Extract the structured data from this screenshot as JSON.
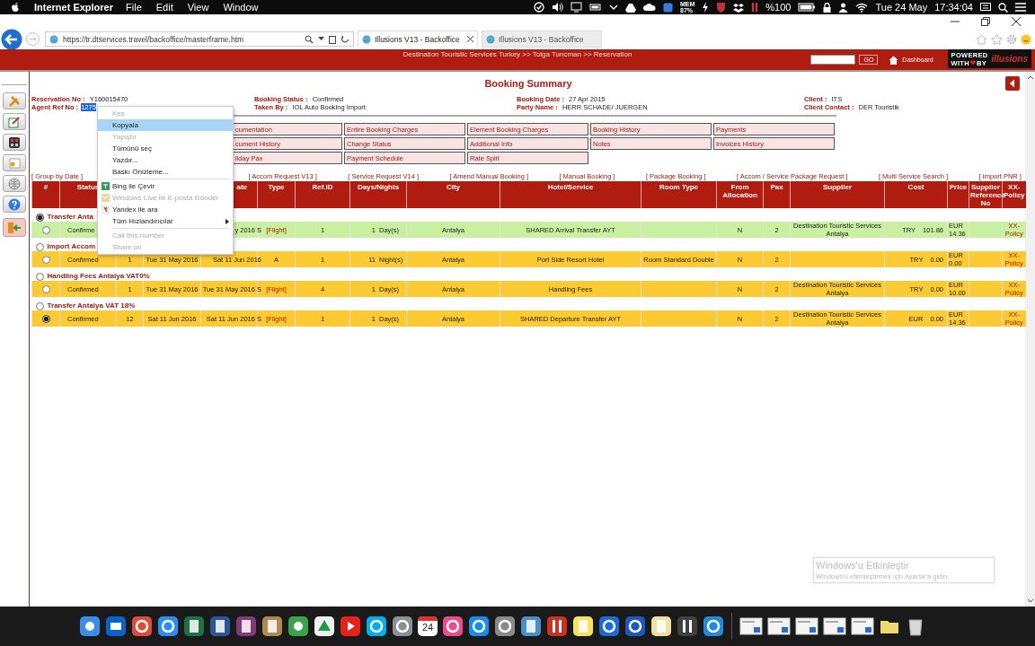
{
  "menubar": {
    "app": "Internet Explorer",
    "menus": [
      "File",
      "Edit",
      "View",
      "Window"
    ],
    "mem_label": "MEM",
    "mem_value": "87%",
    "battery": "%100",
    "date": "Tue 24 May",
    "time": "17:34:04"
  },
  "browser": {
    "address": "https://tr.dtservices.travel/backoffice/masterframe.htm",
    "tabs": [
      {
        "title": "Illusions V13 - Backoffice",
        "selected": true
      },
      {
        "title": "Illusions V13 - Backoffice",
        "selected": false
      }
    ]
  },
  "header": {
    "breadcrumb": "Destination Touristic Services Turkey >> Tolga Tuncman >> Reservation",
    "go": "GO",
    "dashboard": "Dashboard",
    "logo_top": "POWERED",
    "logo_with": "WITH",
    "logo_by": "BY",
    "logo_brand": "illusions"
  },
  "page_title": "Booking Summary",
  "info_columns": [
    [
      {
        "label": "Reservation No :",
        "value": "Y160015470",
        "highlighted": false
      },
      {
        "label": "Agent Ref No :",
        "value": "1275",
        "highlighted": true
      }
    ],
    [
      {
        "label": "Booking Status :",
        "value": "Confirmed",
        "highlighted": false
      },
      {
        "label": "Taken By :",
        "value": "IOL Auto Booking Import",
        "highlighted": false
      }
    ],
    [
      {
        "label": "Booking Date :",
        "value": "27 Apr 2015",
        "highlighted": false
      },
      {
        "label": "Party Name :",
        "value": "HERR SCHADE/ JUERGEN",
        "highlighted": false
      }
    ],
    [
      {
        "label": "Client :",
        "value": "ITS",
        "highlighted": false
      },
      {
        "label": "Client Contact :",
        "value": "DER Touristik",
        "highlighted": false
      }
    ]
  ],
  "actions": [
    [
      "cumentation",
      "Entire Booking Charges",
      "Element Booking Charges",
      "Booking History",
      "Payments"
    ],
    [
      "cument History",
      "Change Status",
      "Additional Info",
      "Notes",
      "Invoices History"
    ],
    [
      "liday Pax",
      "Payment Schedule",
      "Rate Split"
    ]
  ],
  "links": [
    "[ Group by Date ]",
    "[ Accom Request V13 ]",
    "[ Service Request V14 ]",
    "[ Amend Manual Booking ]",
    "[ Manual Booking ]",
    "[ Package Booking ]",
    "[ Accom / Service Package Request ]",
    "[ Multi Service Search ]",
    "[ Import PNR ]"
  ],
  "table": {
    "columns": [
      "#",
      "Status",
      null,
      null,
      "ate",
      "Type",
      "Ref.ID",
      "Days/Nights",
      "City",
      "Hotel/Service",
      "Room Type",
      "From Allocation",
      "Pax",
      "Supplier",
      "Cost",
      "Price",
      "Supplier Reference No",
      "XX-Policy"
    ],
    "groups": [
      {
        "title": "Transfer Anta",
        "selected": true,
        "rows": [
          {
            "selected": false,
            "color": "#c8f0a0",
            "status": "Confirme",
            "end": "y 2016 S",
            "type": "[Flight]",
            "type_link": true,
            "ref_id": "1",
            "days": "1",
            "days_unit": "Day(s)",
            "city": "Antalya",
            "service": "SHARED Arrival Transfer AYT",
            "allocation": "N",
            "pax": "2",
            "supplier": "Destination Touristic Services Antalya",
            "cost_currency": "TRY",
            "cost": "101.86",
            "price_currency": "EUR",
            "price": "14.36",
            "policy": "XX-Policy"
          }
        ]
      },
      {
        "title": "Import Accom",
        "selected": false,
        "rows": [
          {
            "selected": false,
            "color": "#fccb33",
            "status": "Confirmed",
            "count": "1",
            "start": "Tue 31 May 2016",
            "end": "Sat 11 Jun 2016",
            "type": "A",
            "type_link": false,
            "ref_id": "1",
            "days": "11",
            "days_unit": "Night(s)",
            "city": "Antalya",
            "service": "Port Side Resort Hotel",
            "room_type": "Room Standard Double",
            "allocation": "N",
            "pax": "2",
            "cost_currency": "TRY",
            "cost": "0.00",
            "price_currency": "EUR",
            "price": "0.00",
            "policy": "XX-Policy"
          }
        ]
      },
      {
        "title": "Handling Fees Antalya VAT0%",
        "selected": false,
        "rows": [
          {
            "selected": false,
            "color": "#fccb33",
            "status": "Confirmed",
            "count": "1",
            "start": "Tue 31 May 2016",
            "end": "Tue 31 May 2016 S",
            "type": "[Flight]",
            "type_link": true,
            "ref_id": "4",
            "days": "1",
            "days_unit": "Day(s)",
            "city": "Antalya",
            "service": "Handling Fees",
            "allocation": "N",
            "pax": "2",
            "supplier": "Destination Touristic Services Antalya",
            "cost_currency": "TRY",
            "cost": "0.00",
            "price_currency": "EUR",
            "price": "10.00",
            "policy": "XX-Policy"
          }
        ]
      },
      {
        "title": "Transfer Antalya VAT 18%",
        "selected": false,
        "rows": [
          {
            "selected": true,
            "color": "#fccb33",
            "status": "Confirmed",
            "count": "12",
            "start": "Sat 11 Jun 2016",
            "end": "Sat 11 Jun 2016 S",
            "type": "[Flight]",
            "type_link": true,
            "ref_id": "1",
            "days": "1",
            "days_unit": "Day(s)",
            "city": "Antalya",
            "service": "SHARED Departure Transfer AYT",
            "allocation": "N",
            "pax": "2",
            "supplier": "Destination Touristic Services Antalya",
            "cost_currency": "EUR",
            "cost": "0.00",
            "price_currency": "EUR",
            "price": "14.36",
            "policy": "XX-Policy"
          }
        ]
      }
    ]
  },
  "context_menu": [
    {
      "label": "Kes",
      "disabled": true,
      "selected": false,
      "kind": "plain",
      "separator_before": false
    },
    {
      "label": "Kopyala",
      "disabled": false,
      "selected": true,
      "kind": "plain",
      "separator_before": false
    },
    {
      "label": "Yapıştır",
      "disabled": true,
      "selected": false,
      "kind": "plain",
      "separator_before": false
    },
    {
      "label": "Tümünü seç",
      "disabled": false,
      "selected": false,
      "kind": "plain",
      "separator_before": false
    },
    {
      "label": "Yazdır...",
      "disabled": false,
      "selected": false,
      "kind": "plain",
      "separator_before": false
    },
    {
      "label": "Baskı Önizleme...",
      "disabled": false,
      "selected": false,
      "kind": "plain",
      "separator_before": false
    },
    {
      "label": "Bing ile Çevir",
      "disabled": false,
      "selected": false,
      "kind": "icon",
      "separator_before": true
    },
    {
      "label": "Windows Live ile E-posta Gönder",
      "disabled": true,
      "selected": false,
      "kind": "icon",
      "separator_before": false
    },
    {
      "label": "Yandex ile ara",
      "disabled": false,
      "selected": false,
      "kind": "icon",
      "separator_before": false
    },
    {
      "label": "Tüm Hızlandırıcılar",
      "disabled": false,
      "selected": false,
      "kind": "submenu",
      "separator_before": false
    },
    {
      "label": "Call this number",
      "disabled": true,
      "selected": false,
      "kind": "plain",
      "separator_before": true
    },
    {
      "label": "Share on",
      "disabled": true,
      "selected": false,
      "kind": "plain",
      "separator_before": false
    }
  ],
  "activation": {
    "title": "Windows'u Etkinleştir",
    "text": "Windows'u etkinleştirmek için Ayarlar'a gidin."
  },
  "dock": {
    "calendar_day": "24"
  }
}
